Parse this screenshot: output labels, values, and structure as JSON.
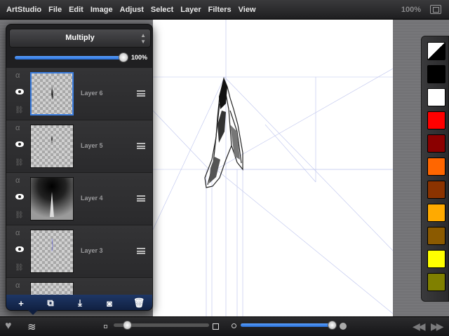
{
  "menubar": {
    "items": [
      "ArtStudio",
      "File",
      "Edit",
      "Image",
      "Adjust",
      "Select",
      "Layer",
      "Filters",
      "View"
    ],
    "zoom": "100%",
    "fullscreen_icon": "fullscreen-icon"
  },
  "layer_panel": {
    "blend_mode": "Multiply",
    "opacity_label": "100%",
    "opacity_value": 1.0,
    "layers": [
      {
        "name": "Layer 6",
        "visible": true,
        "selected": true
      },
      {
        "name": "Layer 5",
        "visible": true,
        "selected": false
      },
      {
        "name": "Layer 4",
        "visible": true,
        "selected": false
      },
      {
        "name": "Layer 3",
        "visible": true,
        "selected": false
      }
    ],
    "layer_icons": {
      "alpha": "α",
      "link": "⛓"
    },
    "toolbar": {
      "add": "+",
      "duplicate": "⧉",
      "merge": "⤓",
      "mask": "◙",
      "delete": "🗑"
    }
  },
  "palette": {
    "colors": [
      "#000000",
      "#ffffff",
      "#ff0000",
      "#8b0000",
      "#ff6600",
      "#8b3300",
      "#ffaa00",
      "#8b5a00",
      "#ffff00",
      "#808000"
    ]
  },
  "bottombar": {
    "heart_icon": "♥",
    "layers_icon": "≋",
    "brush_size_value": 0.05,
    "brush_opacity_value": 0.95,
    "undo_icon": "◀◀",
    "redo_icon": "▶▶"
  }
}
